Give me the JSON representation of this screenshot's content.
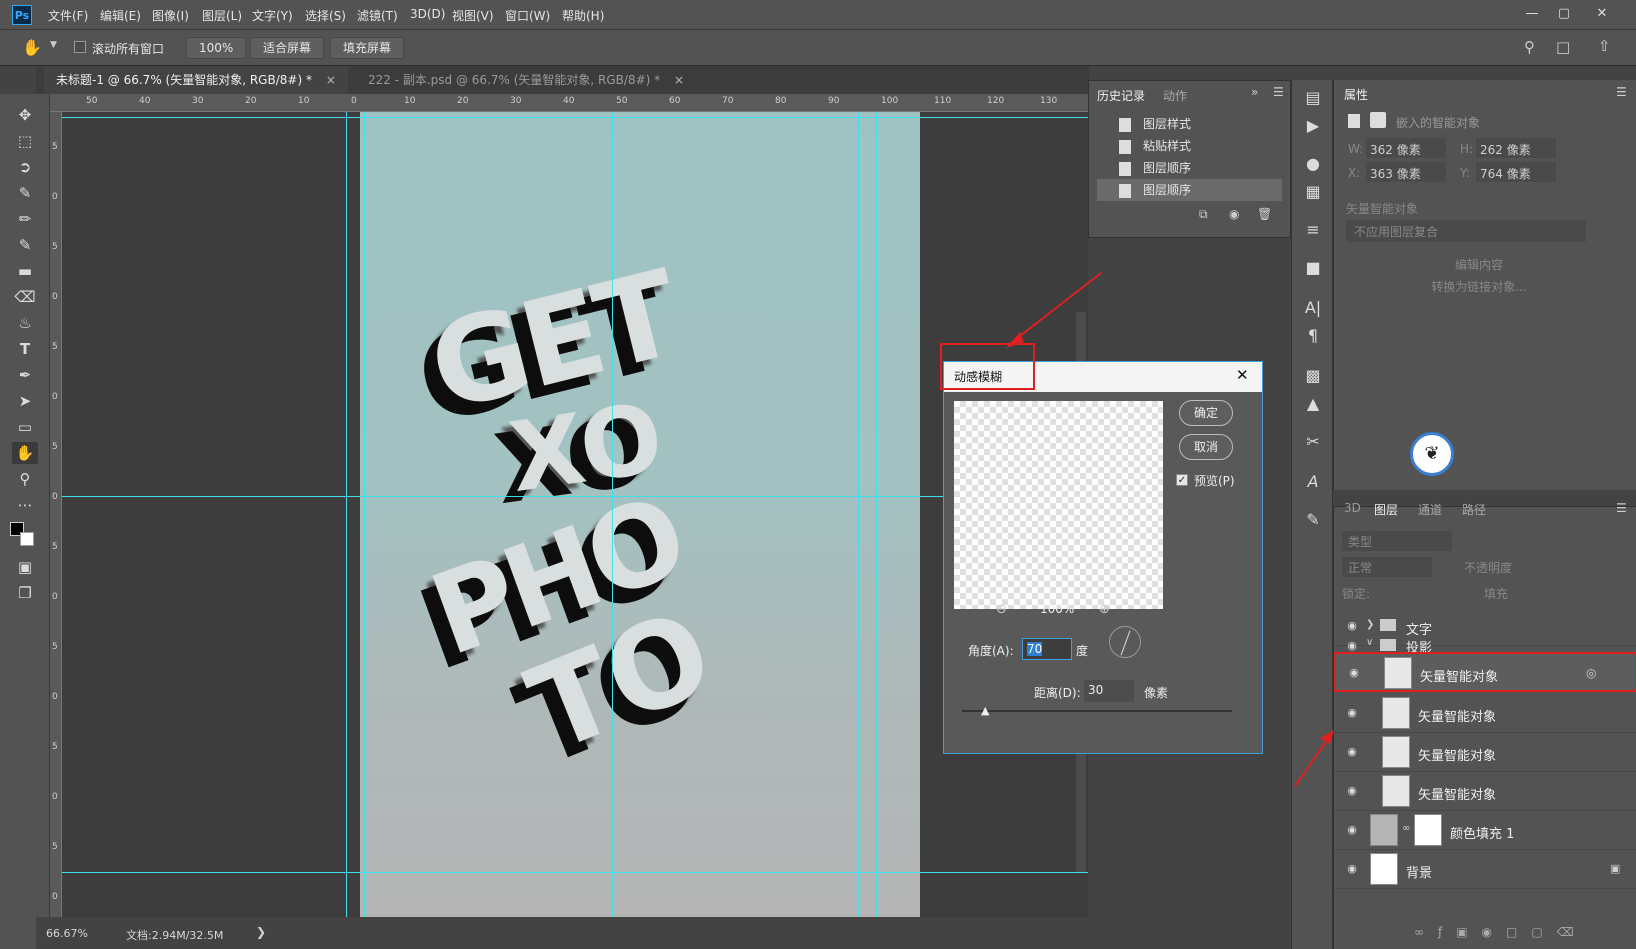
{
  "app": {
    "logo": "Ps"
  },
  "menu": [
    "文件(F)",
    "编辑(E)",
    "图像(I)",
    "图层(L)",
    "文字(Y)",
    "选择(S)",
    "滤镜(T)",
    "3D(D)",
    "视图(V)",
    "窗口(W)",
    "帮助(H)"
  ],
  "options": {
    "scroll_all": "滚动所有窗口",
    "zoom": "100%",
    "fit_screen": "适合屏幕",
    "fill_screen": "填充屏幕"
  },
  "tabs": [
    {
      "label": "未标题-1 @ 66.7% (矢量智能对象, RGB/8#) *",
      "active": true
    },
    {
      "label": "222 - 副本.psd @ 66.7% (矢量智能对象, RGB/8#) *",
      "active": false
    }
  ],
  "ruler": {
    "top": [
      "50",
      "40",
      "30",
      "20",
      "10",
      "0",
      "10",
      "20",
      "30",
      "40",
      "50",
      "60",
      "70",
      "80",
      "90",
      "100",
      "110",
      "120",
      "130"
    ],
    "left": [
      "5",
      "0",
      "5",
      "0",
      "5",
      "0",
      "5",
      "0",
      "5",
      "0",
      "5",
      "0",
      "5",
      "0",
      "5",
      "0"
    ]
  },
  "artwork": {
    "lines": [
      "GET",
      "XO",
      "PHO",
      "TO"
    ]
  },
  "status": {
    "zoom": "66.67%",
    "doc": "文档:2.94M/32.5M"
  },
  "history": {
    "tabs": [
      "历史记录",
      "动作"
    ],
    "items": [
      "图层样式",
      "粘贴样式",
      "图层顺序",
      "图层顺序"
    ]
  },
  "properties": {
    "title": "属性",
    "header": "嵌入的智能对象",
    "w": "362 像素",
    "h": "262 像素",
    "x": "363 像素",
    "y": "764 像素",
    "w_label": "W:",
    "h_label": "H:",
    "x_label": "X:",
    "y_label": "Y:",
    "smart_filter": "矢量智能对象",
    "unavailable": "不应用图层复合",
    "edit_content": "编辑内容",
    "convert": "转换为链接对象..."
  },
  "layers_panel": {
    "tabs": [
      "3D",
      "图层",
      "通道",
      "路径"
    ],
    "search_placeholder": "类型",
    "mode": "正常",
    "opacity": "不透明度",
    "lock": "锁定:",
    "fill": "填充",
    "rows": [
      {
        "name": "文字",
        "type": "group",
        "collapsed": true
      },
      {
        "name": "投影",
        "type": "group",
        "collapsed": false
      },
      {
        "name": "矢量智能对象",
        "type": "smart",
        "selected": true
      },
      {
        "name": "矢量智能对象",
        "type": "smart"
      },
      {
        "name": "矢量智能对象",
        "type": "smart"
      },
      {
        "name": "矢量智能对象",
        "type": "smart"
      },
      {
        "name": "颜色填充 1",
        "type": "fill"
      },
      {
        "name": "背景",
        "type": "background"
      }
    ]
  },
  "dialog": {
    "title": "动感模糊",
    "ok": "确定",
    "cancel": "取消",
    "preview_label": "预览(P)",
    "preview_checked": true,
    "zoom": "100%",
    "angle_label": "角度(A):",
    "angle_value": "70",
    "angle_unit": "度",
    "distance_label": "距离(D):",
    "distance_value": "30",
    "distance_unit": "像素"
  },
  "colors": {
    "accent_red": "#e02020",
    "guide": "#3fe0e8",
    "panel": "#535353",
    "dialog_border": "#3fa0d8"
  }
}
